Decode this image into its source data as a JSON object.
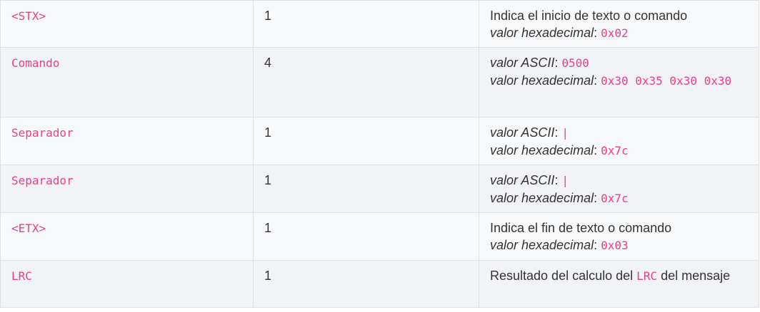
{
  "table": {
    "rows": [
      {
        "field": "<STX>",
        "length": "1",
        "desc_text": "Indica el inicio de texto o comando",
        "hex_label": "valor hexadecimal",
        "hex_value": "0x02"
      },
      {
        "field": "Comando",
        "length": "4",
        "ascii_label": "valor ASCII",
        "ascii_value": "0500",
        "hex_label": "valor hexadecimal",
        "hex_value": "0x30 0x35 0x30 0x30"
      },
      {
        "field": "Separador",
        "length": "1",
        "ascii_label": "valor ASCII",
        "ascii_value": "|",
        "hex_label": "valor hexadecimal",
        "hex_value": "0x7c"
      },
      {
        "field": "Separador",
        "length": "1",
        "ascii_label": "valor ASCII",
        "ascii_value": "|",
        "hex_label": "valor hexadecimal",
        "hex_value": "0x7c"
      },
      {
        "field": "<ETX>",
        "length": "1",
        "desc_text": "Indica el fin de texto o comando",
        "hex_label": "valor hexadecimal",
        "hex_value": "0x03"
      },
      {
        "field": "LRC",
        "length": "1",
        "desc_before": "Resultado del calculo del",
        "desc_code": "LRC",
        "desc_after": "del mensaje"
      }
    ]
  },
  "colors": {
    "code": "#e83e8c",
    "text": "#333333",
    "border": "#dfe2e5",
    "row_bg_light": "#f8f9fb",
    "row_bg_dark": "#f1f3f6"
  }
}
